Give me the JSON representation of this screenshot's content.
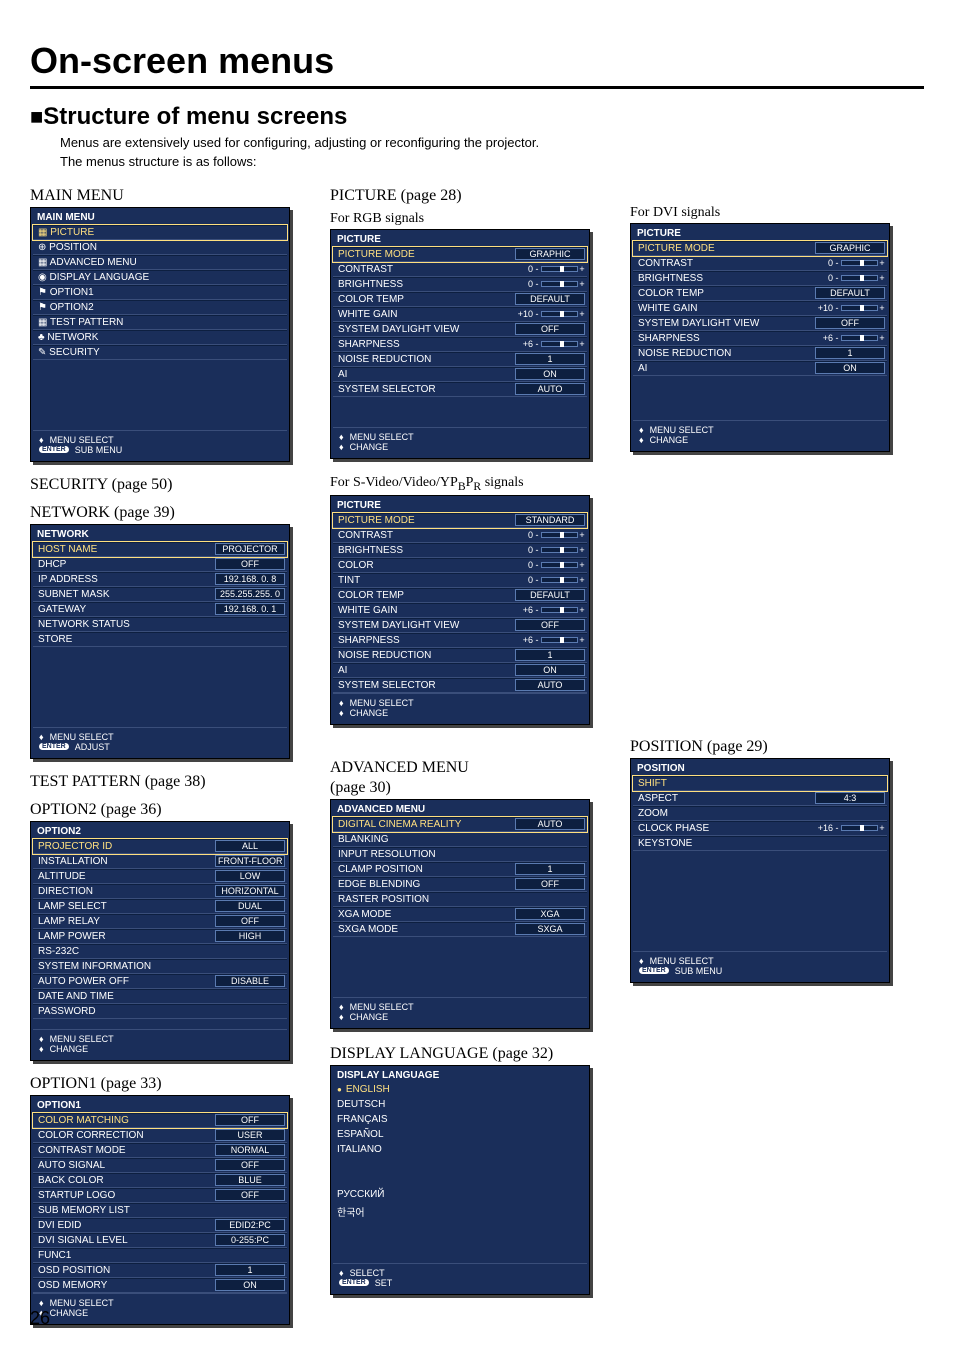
{
  "page_title": "On-screen menus",
  "section_title": "Structure of menu screens",
  "intro_1": "Menus are extensively used for configuring, adjusting or reconfiguring the projector.",
  "intro_2": "The menus structure is as follows:",
  "page_number": "26",
  "labels": {
    "main_menu": "MAIN MENU",
    "security": "SECURITY (page 50)",
    "network": "NETWORK (page 39)",
    "test_pattern": "TEST PATTERN (page 38)",
    "option2": "OPTION2 (page 36)",
    "option1": "OPTION1 (page 33)",
    "picture": "PICTURE (page 28)",
    "for_rgb": "For RGB signals",
    "for_dvi": "For DVI signals",
    "for_svideo": "For S-Video/Video/YPBPR signals",
    "advanced_menu": "ADVANCED MENU",
    "advanced_page": "(page 30)",
    "display_language": "DISPLAY LANGUAGE (page 32)",
    "position": "POSITION (page 29)"
  },
  "footer": {
    "menu_select": "MENU SELECT",
    "sub_menu": "SUB MENU",
    "adjust": "ADJUST",
    "change": "CHANGE",
    "select": "SELECT",
    "set": "SET",
    "enter": "ENTER"
  },
  "main_menu": {
    "title": "MAIN MENU",
    "items": [
      {
        "name": "PICTURE",
        "sel": true
      },
      {
        "name": "POSITION"
      },
      {
        "name": "ADVANCED MENU"
      },
      {
        "name": "DISPLAY LANGUAGE"
      },
      {
        "name": "OPTION1"
      },
      {
        "name": "OPTION2"
      },
      {
        "name": "TEST PATTERN"
      },
      {
        "name": "NETWORK"
      },
      {
        "name": "SECURITY"
      }
    ]
  },
  "network": {
    "title": "NETWORK",
    "items": [
      {
        "name": "HOST NAME",
        "val": "PROJECTOR",
        "sel": true
      },
      {
        "name": "DHCP",
        "val": "OFF"
      },
      {
        "name": "IP ADDRESS",
        "val": "192.168.  0.  8"
      },
      {
        "name": "SUBNET MASK",
        "val": "255.255.255.  0"
      },
      {
        "name": "GATEWAY",
        "val": "192.168.  0.  1"
      },
      {
        "name": "NETWORK STATUS"
      },
      {
        "name": "STORE"
      }
    ]
  },
  "option2": {
    "title": "OPTION2",
    "items": [
      {
        "name": "PROJECTOR ID",
        "val": "ALL",
        "sel": true
      },
      {
        "name": "INSTALLATION",
        "val": "FRONT-FLOOR"
      },
      {
        "name": "ALTITUDE",
        "val": "LOW"
      },
      {
        "name": "DIRECTION",
        "val": "HORIZONTAL"
      },
      {
        "name": "LAMP SELECT",
        "val": "DUAL"
      },
      {
        "name": "LAMP RELAY",
        "val": "OFF"
      },
      {
        "name": "LAMP POWER",
        "val": "HIGH"
      },
      {
        "name": "RS-232C"
      },
      {
        "name": "SYSTEM INFORMATION"
      },
      {
        "name": "AUTO POWER OFF",
        "val": "DISABLE"
      },
      {
        "name": "DATE AND TIME"
      },
      {
        "name": "PASSWORD"
      }
    ]
  },
  "option1": {
    "title": "OPTION1",
    "items": [
      {
        "name": "COLOR MATCHING",
        "val": "OFF",
        "sel": true
      },
      {
        "name": "COLOR CORRECTION",
        "val": "USER"
      },
      {
        "name": "CONTRAST MODE",
        "val": "NORMAL"
      },
      {
        "name": "AUTO SIGNAL",
        "val": "OFF"
      },
      {
        "name": "BACK COLOR",
        "val": "BLUE"
      },
      {
        "name": "STARTUP LOGO",
        "val": "OFF"
      },
      {
        "name": "SUB MEMORY LIST"
      },
      {
        "name": "DVI EDID",
        "val": "EDID2:PC"
      },
      {
        "name": "DVI SIGNAL LEVEL",
        "val": "0-255:PC"
      },
      {
        "name": "FUNC1"
      },
      {
        "name": "OSD POSITION",
        "val": "1"
      },
      {
        "name": "OSD MEMORY",
        "val": "ON"
      }
    ]
  },
  "picture_rgb": {
    "title": "PICTURE",
    "items": [
      {
        "name": "PICTURE MODE",
        "val": "GRAPHIC",
        "sel": true
      },
      {
        "name": "CONTRAST",
        "slider": "0"
      },
      {
        "name": "BRIGHTNESS",
        "slider": "0"
      },
      {
        "name": "COLOR TEMP",
        "val": "DEFAULT"
      },
      {
        "name": "WHITE GAIN",
        "slider": "+10"
      },
      {
        "name": "SYSTEM DAYLIGHT VIEW",
        "val": "OFF"
      },
      {
        "name": "SHARPNESS",
        "slider": "+6"
      },
      {
        "name": "NOISE REDUCTION",
        "val": "1"
      },
      {
        "name": "AI",
        "val": "ON"
      },
      {
        "name": "SYSTEM SELECTOR",
        "val": "AUTO"
      }
    ]
  },
  "picture_dvi": {
    "title": "PICTURE",
    "items": [
      {
        "name": "PICTURE MODE",
        "val": "GRAPHIC",
        "sel": true
      },
      {
        "name": "CONTRAST",
        "slider": "0"
      },
      {
        "name": "BRIGHTNESS",
        "slider": "0"
      },
      {
        "name": "COLOR TEMP",
        "val": "DEFAULT"
      },
      {
        "name": "WHITE GAIN",
        "slider": "+10"
      },
      {
        "name": "SYSTEM DAYLIGHT VIEW",
        "val": "OFF"
      },
      {
        "name": "SHARPNESS",
        "slider": "+6"
      },
      {
        "name": "NOISE REDUCTION",
        "val": "1"
      },
      {
        "name": "AI",
        "val": "ON"
      }
    ]
  },
  "picture_svideo": {
    "title": "PICTURE",
    "items": [
      {
        "name": "PICTURE MODE",
        "val": "STANDARD",
        "sel": true
      },
      {
        "name": "CONTRAST",
        "slider": "0"
      },
      {
        "name": "BRIGHTNESS",
        "slider": "0"
      },
      {
        "name": "COLOR",
        "slider": "0"
      },
      {
        "name": "TINT",
        "slider": "0"
      },
      {
        "name": "COLOR TEMP",
        "val": "DEFAULT"
      },
      {
        "name": "WHITE GAIN",
        "slider": "+6"
      },
      {
        "name": "SYSTEM DAYLIGHT VIEW",
        "val": "OFF"
      },
      {
        "name": "SHARPNESS",
        "slider": "+6"
      },
      {
        "name": "NOISE REDUCTION",
        "val": "1"
      },
      {
        "name": "AI",
        "val": "ON"
      },
      {
        "name": "SYSTEM SELECTOR",
        "val": "AUTO"
      }
    ]
  },
  "advanced": {
    "title": "ADVANCED MENU",
    "items": [
      {
        "name": "DIGITAL CINEMA REALITY",
        "val": "AUTO",
        "sel": true
      },
      {
        "name": "BLANKING"
      },
      {
        "name": "INPUT RESOLUTION"
      },
      {
        "name": "CLAMP POSITION",
        "val": "1"
      },
      {
        "name": "EDGE BLENDING",
        "val": "OFF"
      },
      {
        "name": "RASTER POSITION"
      },
      {
        "name": "XGA MODE",
        "val": "XGA"
      },
      {
        "name": "SXGA MODE",
        "val": "SXGA"
      }
    ]
  },
  "display_language": {
    "title": "DISPLAY LANGUAGE",
    "items": [
      {
        "name": "ENGLISH",
        "sel": true
      },
      {
        "name": "DEUTSCH"
      },
      {
        "name": "FRANÇAIS"
      },
      {
        "name": "ESPAÑOL"
      },
      {
        "name": "ITALIANO"
      },
      {
        "name": ""
      },
      {
        "name": ""
      },
      {
        "name": "РУССКИЙ"
      },
      {
        "name": "한국어"
      },
      {
        "name": ""
      },
      {
        "name": ""
      },
      {
        "name": ""
      }
    ]
  },
  "position": {
    "title": "POSITION",
    "items": [
      {
        "name": "SHIFT",
        "sel": true
      },
      {
        "name": "ASPECT",
        "val": "4:3"
      },
      {
        "name": "ZOOM"
      },
      {
        "name": "CLOCK PHASE",
        "slider": "+16"
      },
      {
        "name": "KEYSTONE"
      }
    ]
  }
}
